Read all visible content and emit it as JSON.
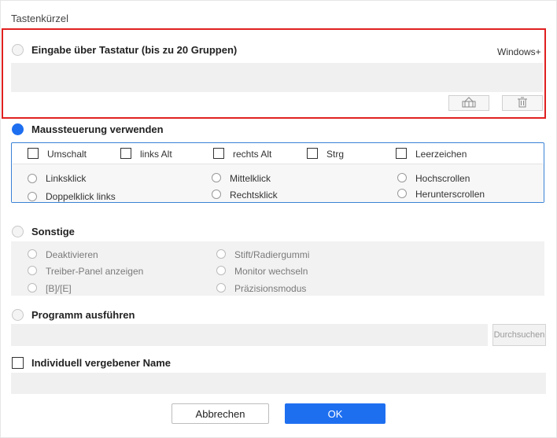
{
  "dialog": {
    "title": "Tastenkürzel"
  },
  "keyboard": {
    "label": "Eingabe über Tastatur (bis zu 20 Gruppen)",
    "modifier_label": "Windows+",
    "input_value": "",
    "add_icon": "keyboard-icon",
    "delete_icon": "trash-icon"
  },
  "mouse": {
    "label": "Maussteuerung verwenden",
    "modifiers": [
      "Umschalt",
      "links Alt",
      "rechts Alt",
      "Strg",
      "Leerzeichen"
    ],
    "actions": [
      "Linksklick",
      "Doppelklick links",
      "Mittelklick",
      "Rechtsklick",
      "Hochscrollen",
      "Herunterscrollen"
    ]
  },
  "other": {
    "label": "Sonstige",
    "options": [
      "Deaktivieren",
      "Treiber-Panel anzeigen",
      "[B]/[E]",
      "Stift/Radiergummi",
      "Monitor wechseln",
      "Präzisionsmodus"
    ]
  },
  "program": {
    "label": "Programm ausführen",
    "path_value": "",
    "browse_label": "Durchsuchen"
  },
  "custom_name": {
    "label": "Individuell vergebener Name",
    "value": ""
  },
  "footer": {
    "cancel_label": "Abbrechen",
    "ok_label": "OK"
  },
  "colors": {
    "accent": "#1e6ff0",
    "highlight": "#e02020",
    "panel_border": "#3a82d6"
  }
}
